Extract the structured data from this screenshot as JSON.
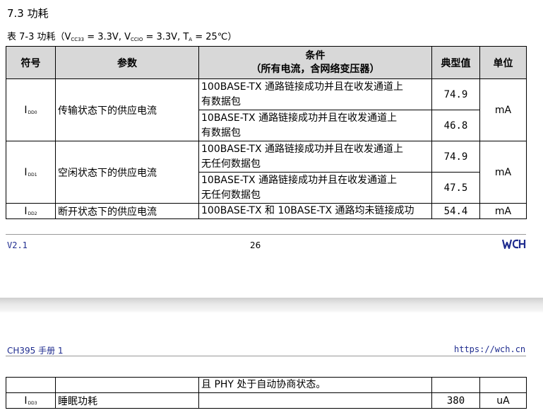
{
  "section_title": "7.3 功耗",
  "table_caption": {
    "prefix": "表 7-3 功耗（V",
    "vcc33_sub": "CC33",
    "mid1": " = 3.3V, V",
    "vccio_sub": "CCIO",
    "mid2": " = 3.3V, T",
    "ta_sub": "A",
    "suffix": " = 25℃）"
  },
  "table_headers": {
    "symbol": "符号",
    "param": "参数",
    "cond_line1": "条件",
    "cond_line2": "（所有电流，含网络变压器）",
    "typical": "典型值",
    "unit": "单位"
  },
  "rows": [
    {
      "symbol": "I",
      "symbol_sub": "DD0",
      "param": "传输状态下的供应电流",
      "unit": "mA",
      "sub": [
        {
          "cond_l1": "100BASE-TX 通路链接成功并且在收发通道上",
          "cond_l2": "有数据包",
          "typ": "74.9"
        },
        {
          "cond_l1": "10BASE-TX 通路链接成功并且在收发通道上",
          "cond_l2": "有数据包",
          "typ": "46.8"
        }
      ]
    },
    {
      "symbol": "I",
      "symbol_sub": "DD1",
      "param": "空闲状态下的供应电流",
      "unit": "mA",
      "sub": [
        {
          "cond_l1": "100BASE-TX 通路链接成功并且在收发通道上",
          "cond_l2": "无任何数据包",
          "typ": "74.9"
        },
        {
          "cond_l1": "10BASE-TX 通路链接成功并且在收发通道上",
          "cond_l2": "无任何数据包",
          "typ": "47.5"
        }
      ]
    },
    {
      "symbol": "I",
      "symbol_sub": "DD2",
      "param": "断开状态下的供应电流",
      "unit": "mA",
      "cond": "100BASE-TX 和 10BASE-TX 通路均未链接成功",
      "typ": "54.4"
    }
  ],
  "footer": {
    "version": "V2.1",
    "page": "26",
    "logo_text": "WCH"
  },
  "next_page": {
    "doc_name": "CH395 手册 1",
    "url": "https://wch.cn",
    "continued_cond": "且 PHY 处于自动协商状态。",
    "row": {
      "symbol": "I",
      "symbol_sub": "DD3",
      "param": "睡眠功耗",
      "cond": "",
      "typ": "380",
      "unit": "uA"
    }
  },
  "colors": {
    "header_bg": "#d8d8d8",
    "link_blue": "#1f2c8f"
  }
}
